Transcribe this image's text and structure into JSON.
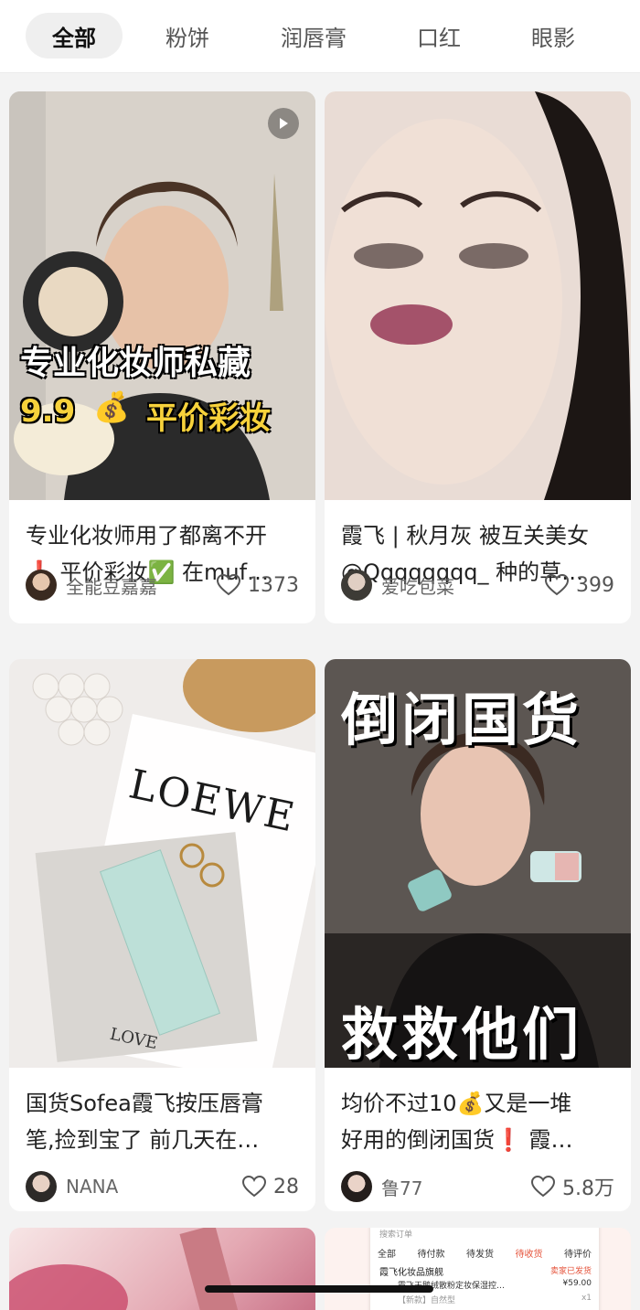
{
  "tabs": [
    "全部",
    "粉饼",
    "润唇膏",
    "口红",
    "眼影"
  ],
  "posts": [
    {
      "overlay": [
        "专业化妆师私藏",
        "9.9",
        "平价彩妆"
      ],
      "title_lines": [
        "专业化妆师用了都离不开",
        "❗ 平价彩妆✅ 在muf…"
      ],
      "author": "全能豆嘉嘉",
      "likes": "1373"
    },
    {
      "title_lines": [
        "霞飞 | 秋月灰 被互关美女",
        "@Qqqqqqqq_ 种的草…"
      ],
      "author": "爱吃包菜",
      "likes": "399"
    },
    {
      "overlay": [
        "LOEWE",
        "LOVE"
      ],
      "title_lines": [
        "国货Sofea霞飞按压唇膏",
        "笔,捡到宝了 前几天在…"
      ],
      "author": "NANA",
      "likes": "28"
    },
    {
      "overlay": [
        "倒闭国货",
        "救救他们"
      ],
      "title_lines": [
        "均价不过10💰又是一堆",
        "好用的倒闭国货❗ 霞…"
      ],
      "author": "鲁77",
      "likes": "5.8万"
    }
  ],
  "preview": {
    "search_placeholder": "搜索订单",
    "tabs": [
      "全部",
      "待付款",
      "待发货",
      "待收货",
      "待评价"
    ],
    "shop": "霞飞化妆品旗舰",
    "status": "卖家已发货",
    "item": "霞飞天鹅绒散粉定妆保湿控…",
    "price": "¥59.00",
    "variant": "【新款】自然型",
    "qty": "x1"
  }
}
